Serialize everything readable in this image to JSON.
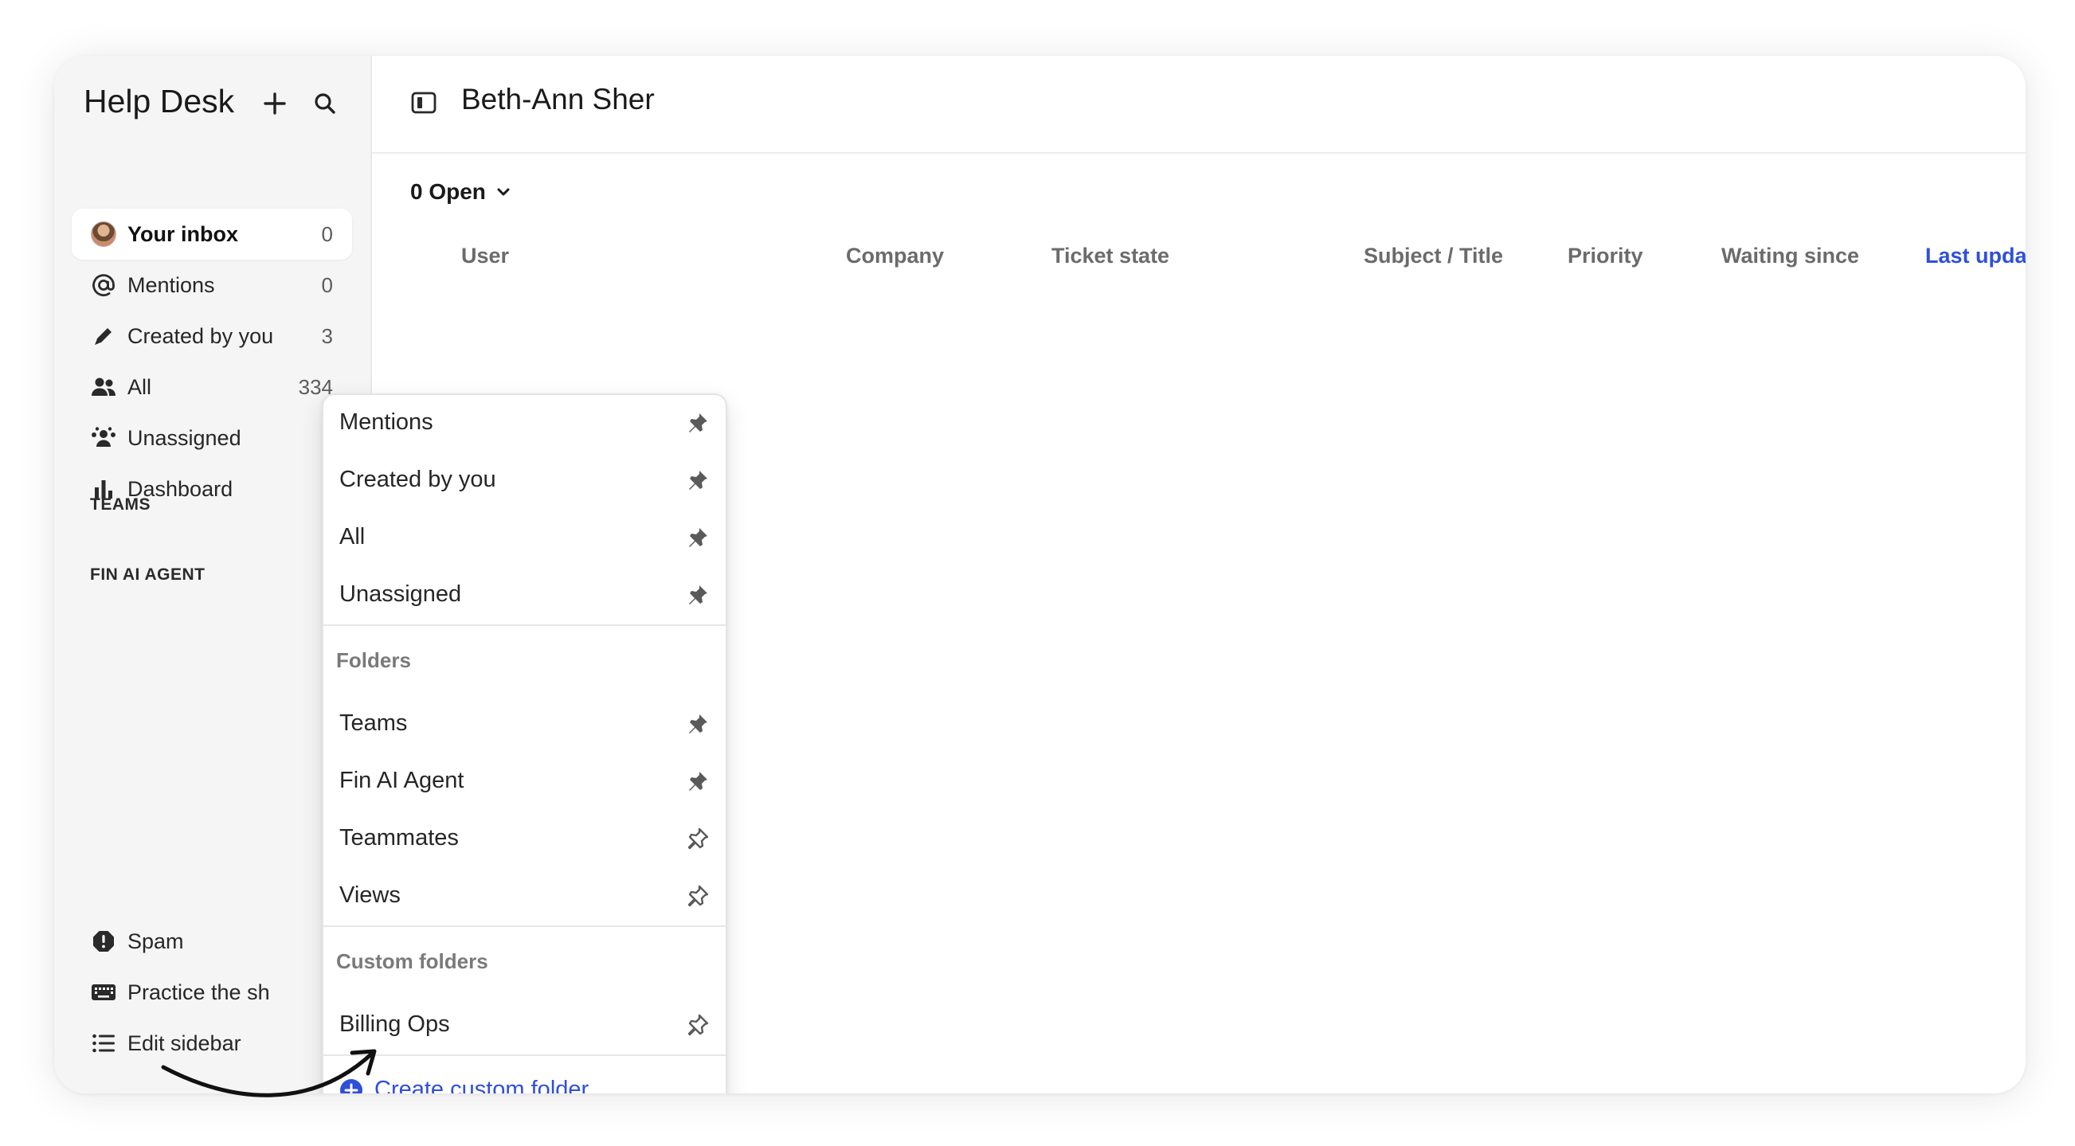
{
  "app": {
    "title": "Help Desk"
  },
  "sidebar": {
    "items": [
      {
        "label": "Your inbox",
        "count": "0"
      },
      {
        "label": "Mentions",
        "count": "0"
      },
      {
        "label": "Created by you",
        "count": "3"
      },
      {
        "label": "All",
        "count": "334"
      },
      {
        "label": "Unassigned",
        "count": ""
      },
      {
        "label": "Dashboard",
        "count": ""
      }
    ],
    "sections": [
      "TEAMS",
      "FIN AI AGENT"
    ],
    "bottom": [
      {
        "label": "Spam"
      },
      {
        "label": "Practice the sh"
      },
      {
        "label": "Edit sidebar"
      }
    ]
  },
  "main": {
    "title": "Beth-Ann Sher",
    "filter": "0 Open",
    "columns": [
      "User",
      "Company",
      "Ticket state",
      "Subject / Title",
      "Priority",
      "Waiting since",
      "Last updated"
    ],
    "sort_indicator": "↓"
  },
  "menu": {
    "items": [
      "Mentions",
      "Created by you",
      "All",
      "Unassigned"
    ],
    "folders_title": "Folders",
    "folders": [
      "Teams",
      "Fin AI Agent",
      "Teammates",
      "Views"
    ],
    "custom_title": "Custom folders",
    "custom": [
      "Billing Ops"
    ],
    "create_label": "Create custom folder"
  },
  "colors": {
    "accent": "#2f4fd8",
    "sidebar_bg": "#f5f5f5"
  }
}
